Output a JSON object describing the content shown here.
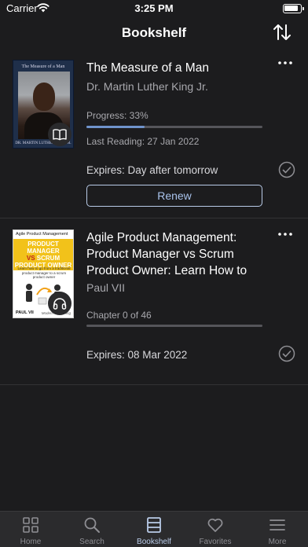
{
  "status_bar": {
    "carrier": "Carrier",
    "time": "3:25 PM"
  },
  "nav": {
    "title": "Bookshelf",
    "sort_icon": "sort-arrows-icon"
  },
  "books": [
    {
      "title": "The Measure of a Man",
      "author": "Dr. Martin Luther King Jr.",
      "type_icon": "book-icon",
      "cover": {
        "title": "The Measure of a Man",
        "author": "DR. MARTIN LUTHER KING JR."
      },
      "progress_label": "Progress: 33%",
      "progress": 0.33,
      "last_reading": "Last Reading: 27 Jan 2022",
      "expires": "Expires: Day after tomorrow",
      "renew_label": "Renew"
    },
    {
      "title": "Agile Product Management: Product Manager vs Scrum Product Owner: Learn How to",
      "author": "Paul VII",
      "type_icon": "headphones-icon",
      "cover": {
        "small_title": "Agile Product Management",
        "banner_line1": "PRODUCT MANAGER",
        "banner_vs": "VS",
        "banner_line2": "SCRUM",
        "banner_line3": "PRODUCT OWNER",
        "subtitle": "Learn how to go from a traditional product manager to a scrum product owner",
        "author": "PAUL VII",
        "author2": "Modern Publishing"
      },
      "progress_label": "Chapter 0 of 46",
      "progress": 0.0,
      "expires": "Expires: 08 Mar 2022"
    }
  ],
  "tabs": [
    {
      "label": "Home",
      "icon": "grid-icon",
      "active": false
    },
    {
      "label": "Search",
      "icon": "search-icon",
      "active": false
    },
    {
      "label": "Bookshelf",
      "icon": "bookshelf-icon",
      "active": true
    },
    {
      "label": "Favorites",
      "icon": "heart-icon",
      "active": false
    },
    {
      "label": "More",
      "icon": "menu-icon",
      "active": false
    }
  ],
  "colors": {
    "accent": "#b9cbe8",
    "progress_fill": "#6f93cc",
    "background": "#1c1c1e"
  }
}
